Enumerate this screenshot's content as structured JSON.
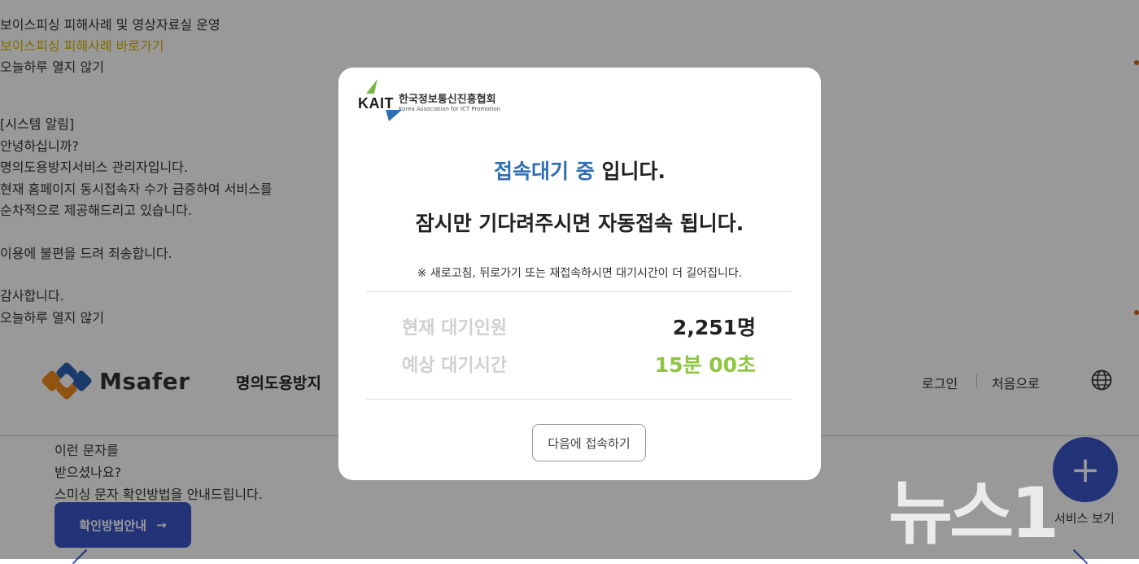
{
  "background": {
    "notice_top": {
      "line1": "보이스피싱 피해사례 및 영상자료실 운영",
      "link": "보이스피싱 피해사례 바로가기",
      "close": "오늘하루 열지 않기"
    },
    "notice_system": {
      "lines": [
        "[시스템 알림]",
        "안녕하십니까?",
        "명의도용방지서비스 관리자입니다.",
        "현재 홈페이지 동시접속자 수가 급증하여 서비스를",
        "순차적으로 제공해드리고 있습니다.",
        "",
        "이용에 불편을 드려 죄송합니다.",
        "",
        "감사합니다."
      ],
      "close": "오늘하루 열지 않기"
    },
    "header": {
      "logo_text": "Msafer",
      "site_title": "명의도용방지",
      "login": "로그인",
      "home": "처음으로"
    },
    "promo": {
      "lines": [
        "이런 문자를",
        "받으셨나요?",
        "스미싱 문자 확인방법을 안내드립니다."
      ],
      "button": "확인방법안내",
      "button_arrow": "→"
    },
    "fab": {
      "icon": "+",
      "label": "서비스 보기"
    },
    "watermark": "뉴스1"
  },
  "modal": {
    "org_logo": {
      "letters": "KAIT",
      "name_ko": "한국정보통신진흥협회",
      "name_en": "Korea Association for ICT Promotion"
    },
    "title_highlight": "접속대기 중",
    "title_rest": " 입니다.",
    "subtitle": "잠시만 기다려주시면 자동접속 됩니다.",
    "note": "※ 새로고침, 뒤로가기 또는 재접속하시면 대기시간이 더 길어집니다.",
    "stats": [
      {
        "label": "현재 대기인원",
        "value": "2,251명"
      },
      {
        "label": "예상 대기시간",
        "value": "15분 00초"
      }
    ],
    "later_button": "다음에 접속하기"
  },
  "colors": {
    "highlight_blue": "#2f6fb2",
    "wait_time_green": "#8dc63f",
    "brand_blue": "#3a55c9",
    "notice_link_yellow": "#d7b400"
  }
}
